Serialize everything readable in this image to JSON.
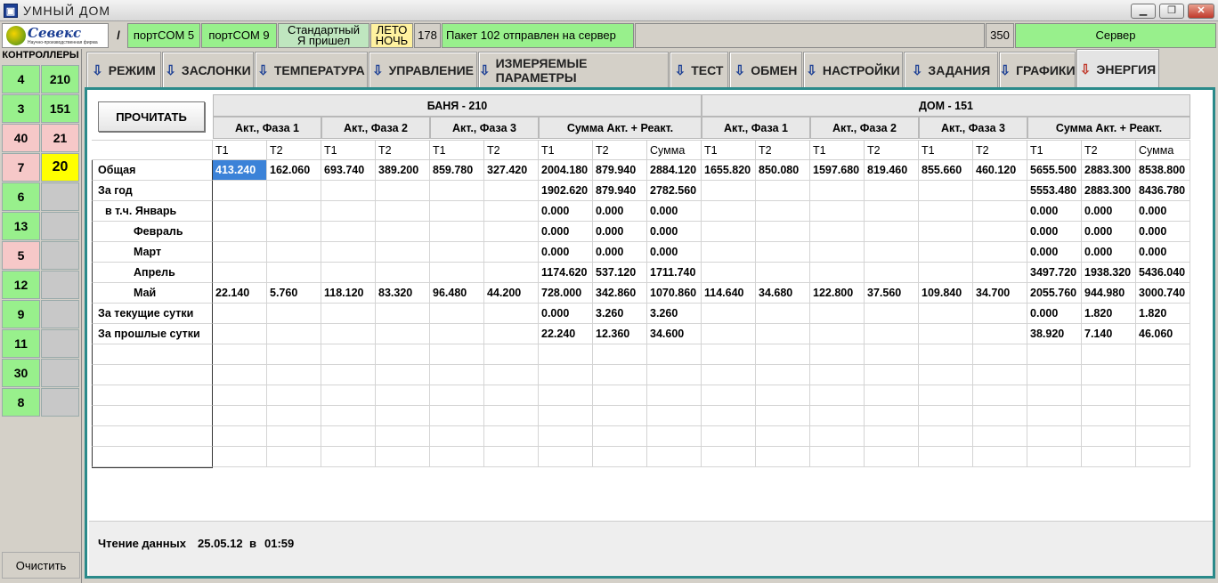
{
  "window": {
    "title": "УМНЫЙ ДОМ",
    "min": "▁",
    "max": "❐",
    "close": "✕"
  },
  "topbar": {
    "logo_name": "Севекс",
    "logo_sub": "Научно-производственная фирма",
    "slash": "/",
    "port1": "портCOM 5",
    "port2": "портCOM 9",
    "mode_line1": "Стандартный",
    "mode_line2": "Я пришел",
    "season_line1": "ЛЕТО",
    "season_line2": "НОЧЬ",
    "count": "178",
    "message": "Пакет 102 отправлен на сервер",
    "server_count": "350",
    "server": "Сервер"
  },
  "sidebar": {
    "title": "КОНТРОЛЛЕРЫ",
    "rows": [
      {
        "a": "4",
        "b": "210"
      },
      {
        "a": "3",
        "b": "151"
      },
      {
        "a": "40",
        "b": "21"
      },
      {
        "a": "7",
        "b": "20"
      },
      {
        "a": "6",
        "b": ""
      },
      {
        "a": "13",
        "b": ""
      },
      {
        "a": "5",
        "b": ""
      },
      {
        "a": "12",
        "b": ""
      },
      {
        "a": "9",
        "b": ""
      },
      {
        "a": "11",
        "b": ""
      },
      {
        "a": "30",
        "b": ""
      },
      {
        "a": "8",
        "b": ""
      }
    ],
    "clear": "Очистить"
  },
  "tabs": [
    {
      "label": "РЕЖИМ"
    },
    {
      "label": "ЗАСЛОНКИ"
    },
    {
      "label": "ТЕМПЕРАТУРА"
    },
    {
      "label": "УПРАВЛЕНИЕ"
    },
    {
      "label": "ИЗМЕРЯЕМЫЕ ПАРАМЕТРЫ"
    },
    {
      "label": "ТЕСТ"
    },
    {
      "label": "ОБМЕН"
    },
    {
      "label": "НАСТРОЙКИ"
    },
    {
      "label": "ЗАДАНИЯ"
    },
    {
      "label": "ГРАФИКИ"
    },
    {
      "label": "ЭНЕРГИЯ"
    }
  ],
  "panel": {
    "read_button": "ПРОЧИТАТЬ",
    "group1": "БАНЯ - 210",
    "group2": "ДОМ - 151",
    "subheaders": [
      "Акт., Фаза 1",
      "Акт., Фаза 2",
      "Акт., Фаза 3",
      "Сумма Акт. + Реакт.",
      "Акт., Фаза 1",
      "Акт., Фаза 2",
      "Акт., Фаза 3",
      "Сумма Акт. + Реакт."
    ],
    "columns": [
      "T1",
      "T2",
      "T1",
      "T2",
      "T1",
      "T2",
      "T1",
      "T2",
      "Сумма",
      "T1",
      "T2",
      "T1",
      "T2",
      "T1",
      "T2",
      "T1",
      "T2",
      "Сумма"
    ],
    "rows": [
      {
        "label": "Общая",
        "cells": [
          "413.240",
          "162.060",
          "693.740",
          "389.200",
          "859.780",
          "327.420",
          "2004.180",
          "879.940",
          "2884.120",
          "1655.820",
          "850.080",
          "1597.680",
          "819.460",
          "855.660",
          "460.120",
          "5655.500",
          "2883.300",
          "8538.800"
        ]
      },
      {
        "label": "За год",
        "cells": [
          "",
          "",
          "",
          "",
          "",
          "",
          "1902.620",
          "879.940",
          "2782.560",
          "",
          "",
          "",
          "",
          "",
          "",
          "5553.480",
          "2883.300",
          "8436.780"
        ]
      },
      {
        "label": "в т.ч. Январь",
        "cells": [
          "",
          "",
          "",
          "",
          "",
          "",
          "0.000",
          "0.000",
          "0.000",
          "",
          "",
          "",
          "",
          "",
          "",
          "0.000",
          "0.000",
          "0.000"
        ]
      },
      {
        "label": "Февраль",
        "cells": [
          "",
          "",
          "",
          "",
          "",
          "",
          "0.000",
          "0.000",
          "0.000",
          "",
          "",
          "",
          "",
          "",
          "",
          "0.000",
          "0.000",
          "0.000"
        ]
      },
      {
        "label": "Март",
        "cells": [
          "",
          "",
          "",
          "",
          "",
          "",
          "0.000",
          "0.000",
          "0.000",
          "",
          "",
          "",
          "",
          "",
          "",
          "0.000",
          "0.000",
          "0.000"
        ]
      },
      {
        "label": "Апрель",
        "cells": [
          "",
          "",
          "",
          "",
          "",
          "",
          "1174.620",
          "537.120",
          "1711.740",
          "",
          "",
          "",
          "",
          "",
          "",
          "3497.720",
          "1938.320",
          "5436.040"
        ]
      },
      {
        "label": "Май",
        "cells": [
          "22.140",
          "5.760",
          "118.120",
          "83.320",
          "96.480",
          "44.200",
          "728.000",
          "342.860",
          "1070.860",
          "114.640",
          "34.680",
          "122.800",
          "37.560",
          "109.840",
          "34.700",
          "2055.760",
          "944.980",
          "3000.740"
        ]
      },
      {
        "label": "За текущие сутки",
        "cells": [
          "",
          "",
          "",
          "",
          "",
          "",
          "0.000",
          "3.260",
          "3.260",
          "",
          "",
          "",
          "",
          "",
          "",
          "0.000",
          "1.820",
          "1.820"
        ]
      },
      {
        "label": "За прошлые сутки",
        "cells": [
          "",
          "",
          "",
          "",
          "",
          "",
          "22.240",
          "12.360",
          "34.600",
          "",
          "",
          "",
          "",
          "",
          "",
          "38.920",
          "7.140",
          "46.060"
        ]
      },
      {
        "label": "",
        "cells": [
          "",
          "",
          "",
          "",
          "",
          "",
          "",
          "",
          "",
          "",
          "",
          "",
          "",
          "",
          "",
          "",
          "",
          ""
        ]
      },
      {
        "label": "",
        "cells": [
          "",
          "",
          "",
          "",
          "",
          "",
          "",
          "",
          "",
          "",
          "",
          "",
          "",
          "",
          "",
          "",
          "",
          ""
        ]
      },
      {
        "label": "",
        "cells": [
          "",
          "",
          "",
          "",
          "",
          "",
          "",
          "",
          "",
          "",
          "",
          "",
          "",
          "",
          "",
          "",
          "",
          ""
        ]
      },
      {
        "label": "",
        "cells": [
          "",
          "",
          "",
          "",
          "",
          "",
          "",
          "",
          "",
          "",
          "",
          "",
          "",
          "",
          "",
          "",
          "",
          ""
        ]
      },
      {
        "label": "",
        "cells": [
          "",
          "",
          "",
          "",
          "",
          "",
          "",
          "",
          "",
          "",
          "",
          "",
          "",
          "",
          "",
          "",
          "",
          ""
        ]
      },
      {
        "label": "",
        "cells": [
          "",
          "",
          "",
          "",
          "",
          "",
          "",
          "",
          "",
          "",
          "",
          "",
          "",
          "",
          "",
          "",
          "",
          ""
        ]
      }
    ],
    "status_label": "Чтение данных",
    "status_date": "25.05.12",
    "status_in": "в",
    "status_time": "01:59"
  },
  "colors": {
    "accent": "#98f08c",
    "selection": "#3b82d8",
    "panel_border": "#2a8a8a"
  }
}
